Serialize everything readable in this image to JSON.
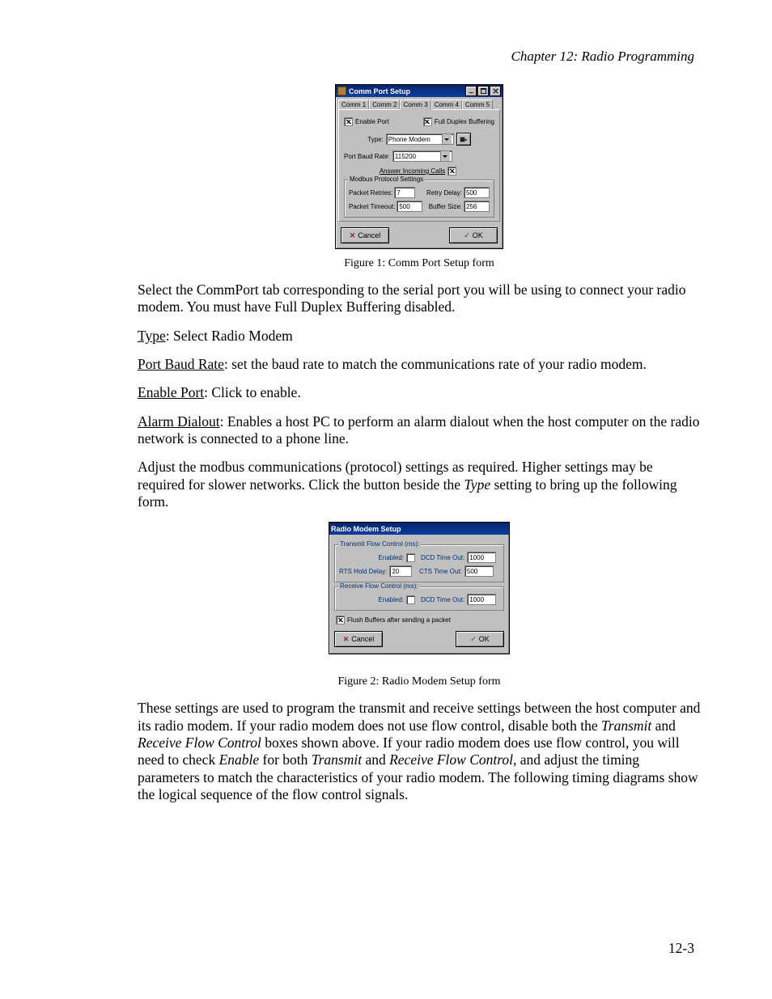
{
  "header": {
    "chapter": "Chapter 12: Radio Programming"
  },
  "footer": {
    "page": "12-3"
  },
  "dialog1": {
    "title": "Comm Port Setup",
    "tabs": [
      "Comm 1",
      "Comm 2",
      "Comm 3",
      "Comm 4",
      "Comm 5"
    ],
    "active_tab_index": 2,
    "enable_port_label": "Enable Port",
    "enable_port_checked": true,
    "full_duplex_label": "Full Duplex Buffering",
    "full_duplex_checked": true,
    "type_label": "Type:",
    "type_value": "Phone Modem",
    "baud_label": "Port Baud Rate:",
    "baud_value": "115200",
    "answer_label": "Answer Incoming Calls",
    "answer_checked": true,
    "group_title": "Modbus Protocol Settings",
    "packet_retries_label": "Packet Retries:",
    "packet_retries_value": "7",
    "retry_delay_label": "Retry Delay:",
    "retry_delay_value": "500",
    "packet_timeout_label": "Packet Timeout:",
    "packet_timeout_value": "500",
    "buffer_size_label": "Buffer Size:",
    "buffer_size_value": "256",
    "cancel": "Cancel",
    "ok": "OK"
  },
  "caption1": "Figure 1: Comm Port Setup form",
  "para1": "Select the CommPort tab corresponding to the serial port you will be using to connect your radio modem. You must have Full Duplex Buffering disabled.",
  "para2_u": "Type",
  "para2_rest": ": Select Radio Modem",
  "para3_u": "Port Baud Rate",
  "para3_rest": ": set the baud rate to match the communications rate of your radio modem.",
  "para4_u": "Enable Port",
  "para4_rest": ": Click to enable.",
  "para5_u": "Alarm Dialout",
  "para5_rest": ": Enables a host PC to perform an alarm dialout when the host computer on the radio network is connected to a phone line.",
  "para6a": "Adjust the modbus communications (protocol) settings as required. Higher settings may be required for slower networks. Click the button beside the ",
  "para6_i": "Type",
  "para6b": " setting to bring up the following form.",
  "dialog2": {
    "title": "Radio Modem Setup",
    "tx_group": "Transmit Flow Control (ms):",
    "enabled_label": "Enabled:",
    "tx_enabled_checked": false,
    "dcd_label": "DCD Time Out:",
    "dcd_value": "1000",
    "rts_label": "RTS Hold Delay:",
    "rts_value": "20",
    "cts_label": "CTS Time Out:",
    "cts_value": "500",
    "rx_group": "Receive Flow Control (ms):",
    "rx_enabled_checked": false,
    "rx_dcd_label": "DCD Time Out:",
    "rx_dcd_value": "1000",
    "flush_checked": true,
    "flush_label": "Flush Buffers after sending a packet",
    "cancel": "Cancel",
    "ok": "OK"
  },
  "caption2": "Figure 2: Radio Modem Setup form",
  "para7a": "These settings are used to program the transmit and receive settings between the host computer and its radio modem. If your radio modem does not use flow control, disable both the ",
  "para7_i1": "Transmit",
  "para7b": " and ",
  "para7_i2": "Receive Flow Control",
  "para7c": " boxes shown above. If your radio modem does use flow control, you will need to check ",
  "para7_i3": "Enable",
  "para7d": " for both ",
  "para7_i4": "Transmit",
  "para7e": " and ",
  "para7_i5": "Receive Flow Control",
  "para7f": ", and adjust the timing parameters to match the characteristics of your radio modem. The following timing diagrams show the logical sequence of the flow control signals."
}
